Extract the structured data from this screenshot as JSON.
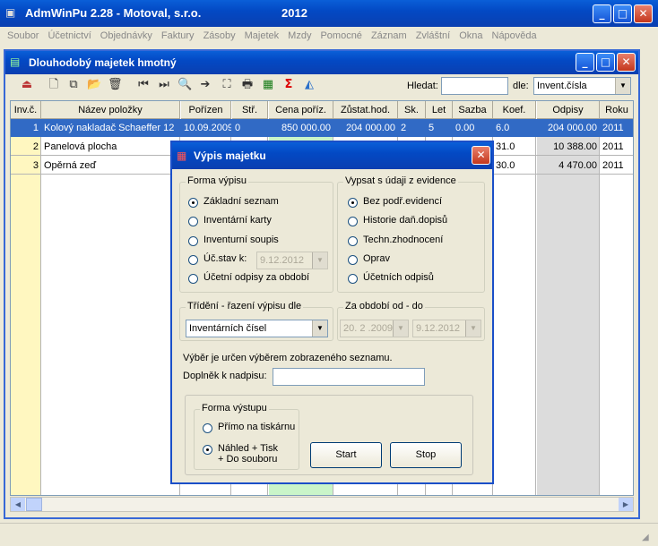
{
  "app": {
    "title": "AdmWinPu 2.28 - Motoval, s.r.o.",
    "year": "2012"
  },
  "menu": [
    "Soubor",
    "Účetnictví",
    "Objednávky",
    "Faktury",
    "Zásoby",
    "Majetek",
    "Mzdy",
    "Pomocné",
    "Záznam",
    "Zvláštní",
    "Okna",
    "Nápověda"
  ],
  "child": {
    "title": "Dlouhodobý majetek hmotný"
  },
  "toolbar": {
    "hledat_label": "Hledat:",
    "hledat_value": "",
    "dle_label": "dle:",
    "dle_value": "Invent.čísla"
  },
  "table": {
    "headers": [
      "Inv.č.",
      "Název položky",
      "Pořízen",
      "Stř.",
      "Cena poříz.",
      "Zůstat.hod.",
      "Sk.",
      "Let",
      "Sazba",
      "Koef.",
      "Odpisy",
      "Roku"
    ],
    "rows": [
      [
        "1",
        "Kolový nakladač Schaeffer 12",
        "10.09.2009",
        "0",
        "850 000.00",
        "204 000.00",
        "2",
        "5",
        "0.00",
        "6.0",
        "204 000.00",
        "2011"
      ],
      [
        "2",
        "Panelová plocha",
        "",
        "",
        "",
        "",
        "",
        "",
        "",
        "31.0",
        "10 388.00",
        "2011"
      ],
      [
        "3",
        "Opěrná zeď",
        "",
        "",
        "",
        "",
        "",
        "",
        "",
        "30.0",
        "4 470.00",
        "2011"
      ]
    ]
  },
  "dialog": {
    "title": "Výpis majetku",
    "forma_vypisu": {
      "legend": "Forma výpisu",
      "options": [
        "Základní seznam",
        "Inventární karty",
        "Inventurní soupis",
        "Úč.stav k:",
        "Účetní odpisy za období"
      ],
      "selected": 0,
      "stav_date": "9.12.2012"
    },
    "vypsat": {
      "legend": "Vypsat s údaji z evidence",
      "options": [
        "Bez podř.evidencí",
        "Historie daň.dopisů",
        "Techn.zhodnocení",
        "Oprav",
        "Účetních odpisů"
      ],
      "selected": 0
    },
    "trideni": {
      "legend": "Třídění - řazení výpisu dle",
      "value": "Inventárních čísel"
    },
    "obdobi": {
      "legend": "Za období od - do",
      "from": "20. 2 .2009",
      "to": "9.12.2012"
    },
    "note": "Výběr je určen výběrem zobrazeného seznamu.",
    "doplnek_label": "Doplněk k nadpisu:",
    "doplnek_value": "",
    "vystup": {
      "legend": "Forma výstupu",
      "options": [
        "Přímo na tiskárnu",
        "Náhled + Tisk\n+ Do souboru"
      ],
      "selected": 1
    },
    "start": "Start",
    "stop": "Stop"
  }
}
